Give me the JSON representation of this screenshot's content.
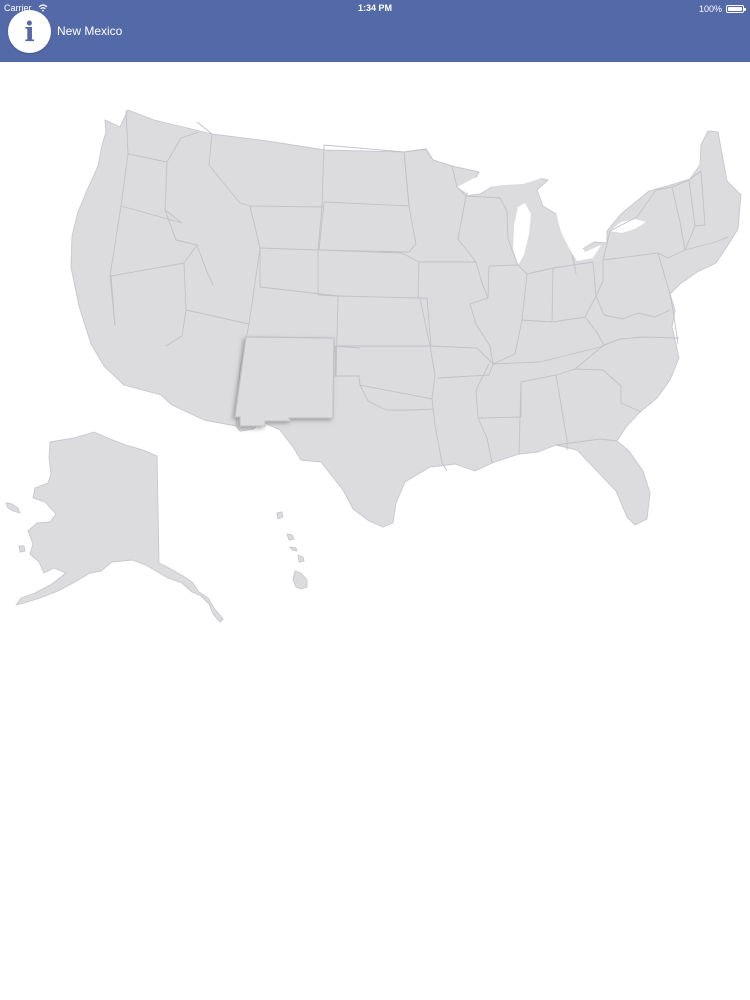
{
  "status_bar": {
    "carrier": "Carrier",
    "time": "1:34 PM",
    "battery": "100%",
    "wifi_icon": "wifi-icon",
    "battery_icon": "battery-icon"
  },
  "header": {
    "title": "New Mexico",
    "info_icon": "info-icon",
    "info_glyph": "i",
    "background_color": "#5369a8"
  },
  "map": {
    "selected_state": "New Mexico",
    "state_fill_color": "#dcdbde",
    "border_color": "#c8c7cc",
    "highlight_shadow": "#666666"
  }
}
